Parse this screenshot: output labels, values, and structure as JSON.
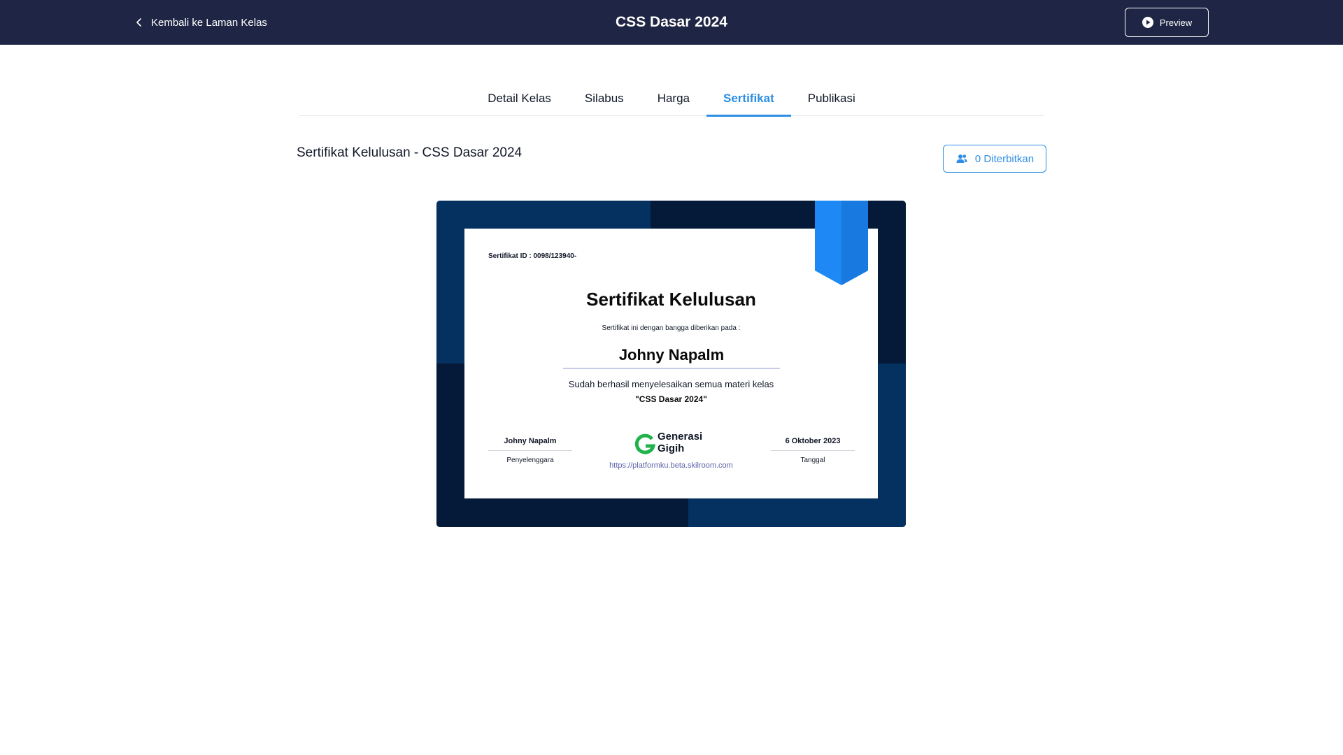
{
  "topbar": {
    "back_label": "Kembali ke Laman Kelas",
    "title": "CSS Dasar 2024",
    "preview_label": "Preview"
  },
  "tabs": [
    {
      "label": "Detail Kelas",
      "active": false
    },
    {
      "label": "Silabus",
      "active": false
    },
    {
      "label": "Harga",
      "active": false
    },
    {
      "label": "Sertifikat",
      "active": true
    },
    {
      "label": "Publikasi",
      "active": false
    }
  ],
  "section": {
    "title": "Sertifikat Kelulusan - CSS Dasar 2024",
    "issued_label": "0 Diterbitkan"
  },
  "certificate": {
    "id_text": "Sertifikat ID : 0098/123940-",
    "heading": "Sertifikat Kelulusan",
    "subtitle": "Sertifikat ini dengan bangga diberikan pada :",
    "recipient": "Johny Napalm",
    "description": "Sudah berhasil menyelesaikan semua materi kelas",
    "course": "\"CSS Dasar 2024\"",
    "organizer_name": "Johny Napalm",
    "organizer_label": "Penyelenggara",
    "date_value": "6 Oktober 2023",
    "date_label": "Tanggal",
    "logo_line1": "Generasi",
    "logo_line2": "Gigih",
    "url": "https://platformku.beta.skilroom.com"
  },
  "colors": {
    "topbar": "#1f2544",
    "accent": "#2d8ee5",
    "frame_dark": "#041a38",
    "frame_blue": "#04315f",
    "ribbon": "#1e88f5",
    "logo_green": "#22b24c"
  },
  "icons": {
    "back": "chevron-left-icon",
    "preview": "play-circle-icon",
    "issued": "users-icon"
  }
}
